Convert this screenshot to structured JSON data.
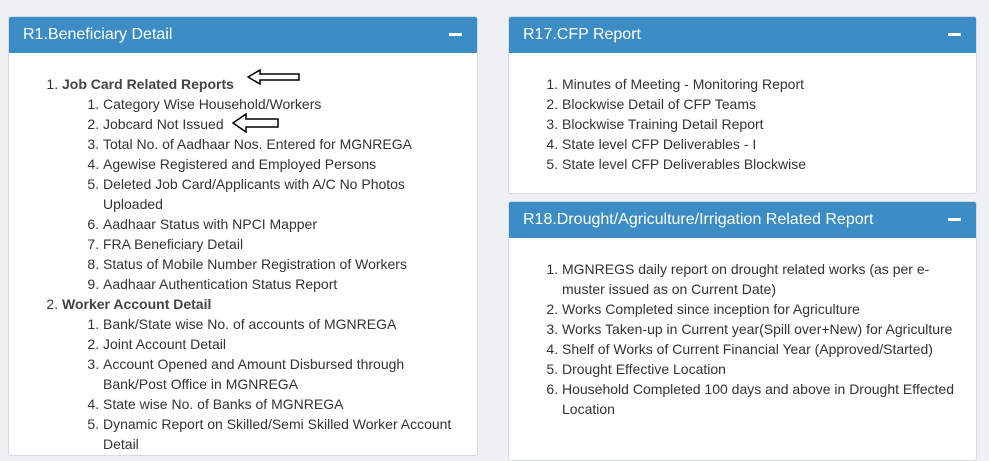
{
  "panels": {
    "r1": {
      "title": "R1.Beneficiary Detail",
      "groups": [
        {
          "label": "Job Card Related Reports",
          "items": [
            "Category Wise Household/Workers",
            "Jobcard Not Issued",
            "Total No. of Aadhaar Nos. Entered for MGNREGA",
            "Agewise Registered and Employed Persons",
            "Deleted Job Card/Applicants with A/C No Photos Uploaded",
            "Aadhaar Status with NPCI Mapper",
            "FRA Beneficiary Detail",
            "Status of Mobile Number Registration of Workers",
            "Aadhaar Authentication Status Report"
          ]
        },
        {
          "label": "Worker Account Detail",
          "items": [
            "Bank/State wise No. of accounts of MGNREGA",
            "Joint Account Detail",
            "Account Opened and Amount Disbursed through Bank/Post Office in MGNREGA",
            "State wise No. of Banks of MGNREGA",
            "Dynamic Report on Skilled/Semi Skilled Worker Account Detail"
          ]
        }
      ]
    },
    "r17": {
      "title": "R17.CFP Report",
      "items": [
        "Minutes of Meeting - Monitoring Report",
        "Blockwise Detail of CFP Teams",
        "Blockwise Training Detail Report",
        "State level CFP Deliverables - I",
        "State level CFP Deliverables Blockwise"
      ]
    },
    "r18": {
      "title": "R18.Drought/Agriculture/Irrigation Related Report",
      "items": [
        "MGNREGS daily report on drought related works (as per e-muster issued as on Current Date)",
        "Works Completed since inception for Agriculture",
        "Works Taken-up in Current year(Spill over+New) for Agriculture",
        "Shelf of Works of Current Financial Year (Approved/Started)",
        "Drought Effective Location",
        "Household Completed 100 days and above in Drought Effected Location"
      ]
    }
  },
  "icons": {
    "collapse": "minus-icon",
    "annotation": "left-arrow-icon"
  },
  "colors": {
    "header": "#3c8dc5",
    "background": "#eef0f3"
  }
}
